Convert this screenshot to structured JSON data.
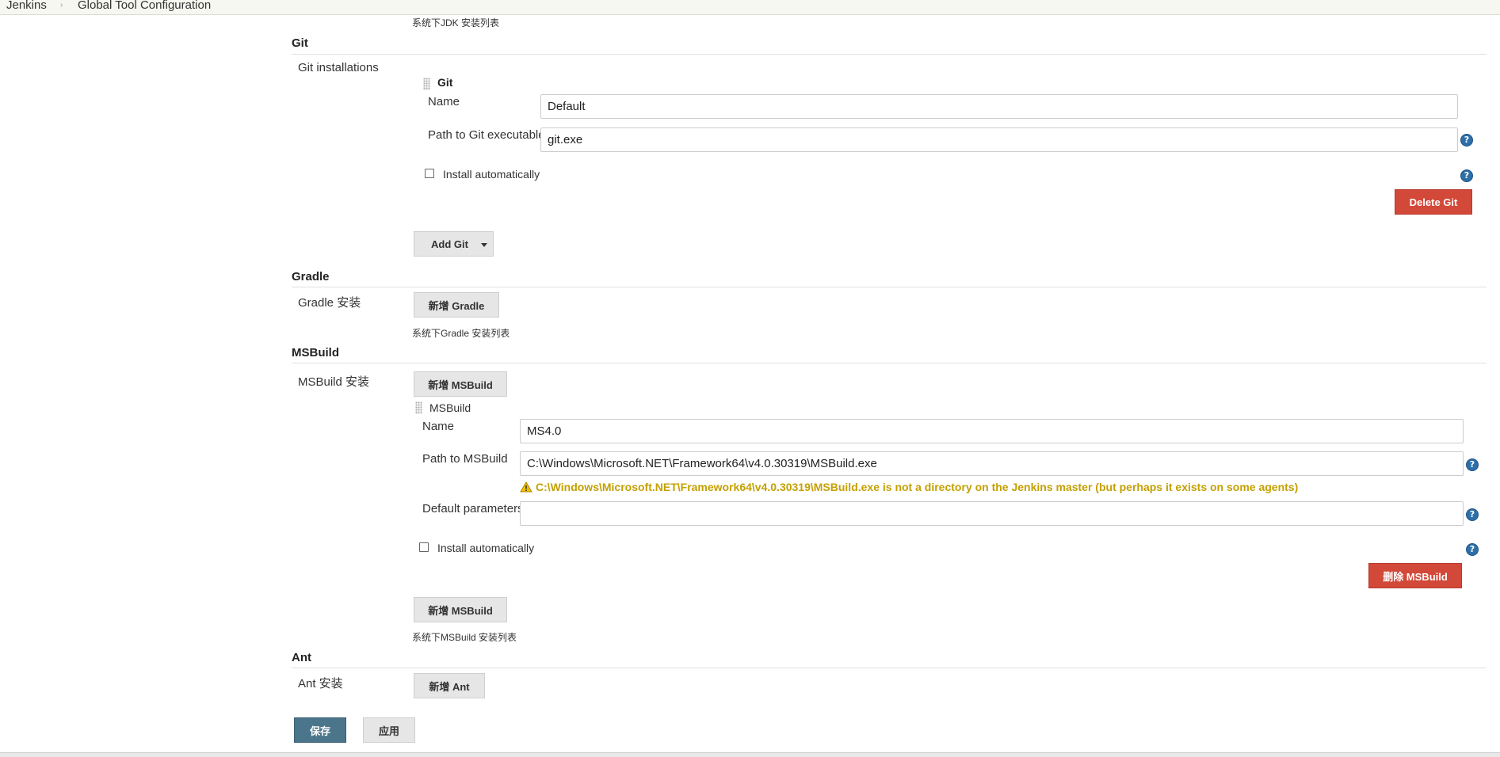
{
  "breadcrumb": {
    "items": [
      "Jenkins",
      "Global Tool Configuration"
    ],
    "separator": "›"
  },
  "jdk": {
    "description": "系统下JDK 安装列表"
  },
  "git": {
    "title": "Git",
    "installations_label": "Git installations",
    "block_title": "Git",
    "name_label": "Name",
    "name_value": "Default",
    "path_label": "Path to Git executable",
    "path_value": "git.exe",
    "install_auto_label": "Install automatically",
    "delete_button": "Delete Git",
    "add_button": "Add Git"
  },
  "gradle": {
    "title": "Gradle",
    "installations_label": "Gradle 安装",
    "add_button": "新增 Gradle",
    "description": "系统下Gradle 安装列表"
  },
  "msbuild": {
    "title": "MSBuild",
    "installations_label": "MSBuild 安装",
    "add_button_top": "新增 MSBuild",
    "block_title": "MSBuild",
    "name_label": "Name",
    "name_value": "MS4.0",
    "path_label": "Path to MSBuild",
    "path_value": "C:\\Windows\\Microsoft.NET\\Framework64\\v4.0.30319\\MSBuild.exe",
    "warning": "C:\\Windows\\Microsoft.NET\\Framework64\\v4.0.30319\\MSBuild.exe is not a directory on the Jenkins master (but perhaps it exists on some agents)",
    "params_label": "Default parameters",
    "params_value": "",
    "install_auto_label": "Install automatically",
    "delete_button": "删除 MSBuild",
    "add_button_bottom": "新增 MSBuild",
    "description": "系统下MSBuild 安装列表"
  },
  "ant": {
    "title": "Ant",
    "installations_label": "Ant 安装",
    "add_button": "新增 Ant"
  },
  "footer": {
    "save_button": "保存",
    "apply_button": "应用"
  },
  "icons": {
    "help": "help-icon",
    "warning": "warning-icon",
    "drag": "drag-handle-icon",
    "dropdown": "chevron-down-icon"
  },
  "colors": {
    "danger": "#d24939",
    "primary": "#4b758b",
    "warning": "#c4a000",
    "help": "#2d6fa8"
  }
}
